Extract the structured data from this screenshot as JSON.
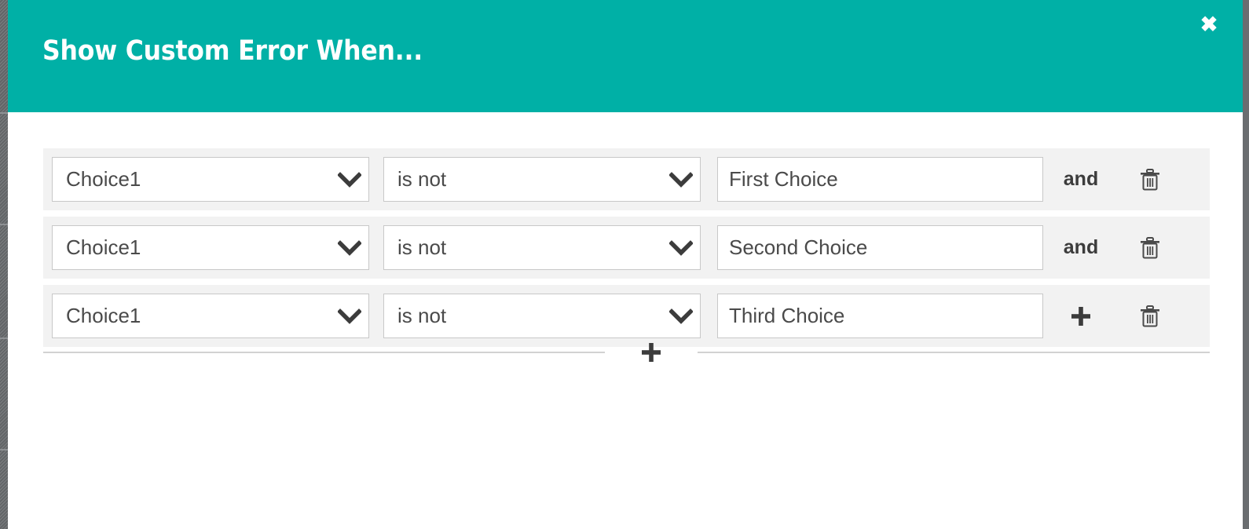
{
  "window": {
    "title": "Show Custom Error When...",
    "accent_color": "#00b0a6",
    "close_icon": "close-icon",
    "close_label": "✖"
  },
  "conditions": {
    "rows": [
      {
        "field": "Choice1",
        "operator": "is not",
        "value": "First Choice",
        "joiner": "and",
        "joiner_type": "text",
        "delete_icon": "trash-icon"
      },
      {
        "field": "Choice1",
        "operator": "is not",
        "value": "Second Choice",
        "joiner": "and",
        "joiner_type": "text",
        "delete_icon": "trash-icon"
      },
      {
        "field": "Choice1",
        "operator": "is not",
        "value": "Third Choice",
        "joiner": "+",
        "joiner_type": "plus",
        "delete_icon": "trash-icon"
      }
    ],
    "field_options": [
      "Choice1"
    ],
    "operator_options": [
      "is not"
    ],
    "value_placeholder": "",
    "chevron_icon": "chevron-down-icon"
  },
  "add_condition_group": {
    "icon": "plus-icon",
    "label": "+"
  }
}
